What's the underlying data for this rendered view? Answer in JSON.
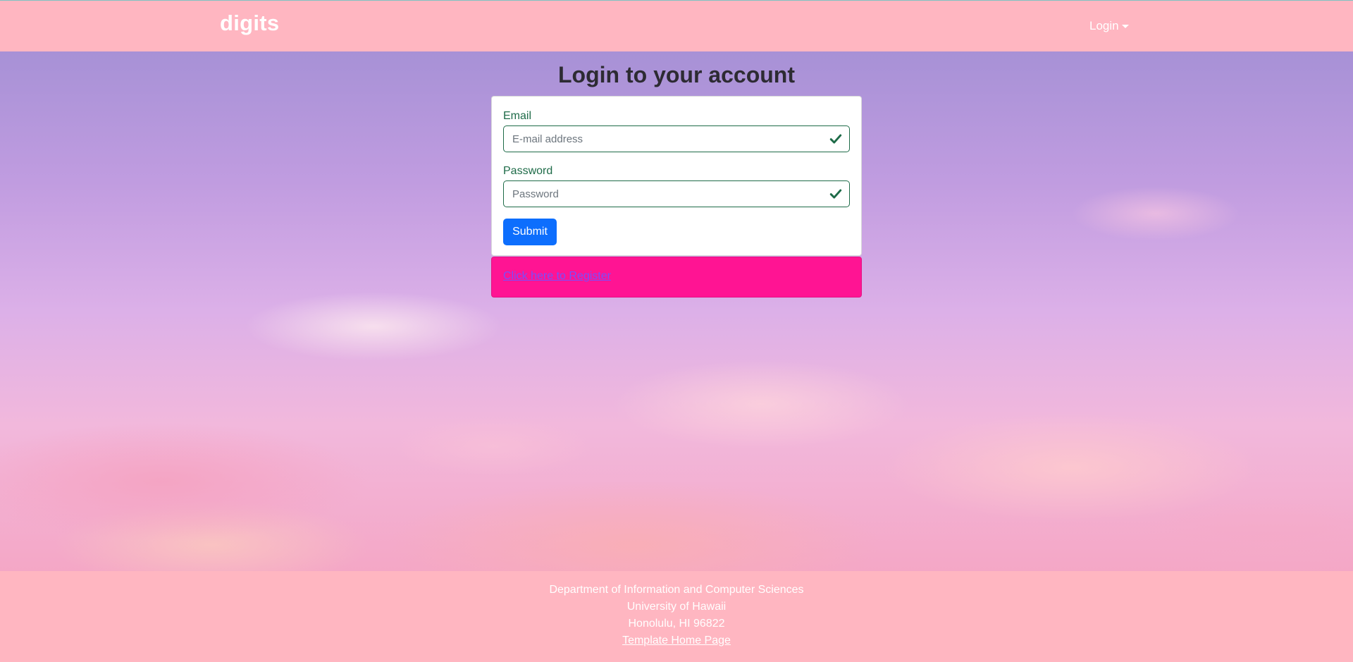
{
  "navbar": {
    "brand": "digits",
    "login_menu": "Login",
    "bg_color": "#ffb6c1"
  },
  "title": "Login to your account",
  "form": {
    "email": {
      "label": "Email",
      "placeholder": "E-mail address",
      "status_icon": "check-icon"
    },
    "password": {
      "label": "Password",
      "placeholder": "Password",
      "status_icon": "check-icon"
    },
    "submit_label": "Submit",
    "accent_color": "#0d6efd",
    "valid_color": "#1e6b48"
  },
  "register": {
    "link_text": "Click here to Register",
    "bg_color": "#ff1493"
  },
  "footer": {
    "line1": "Department of Information and Computer Sciences",
    "line2": "University of Hawaii",
    "line3": "Honolulu, HI 96822",
    "link": "Template Home Page"
  }
}
